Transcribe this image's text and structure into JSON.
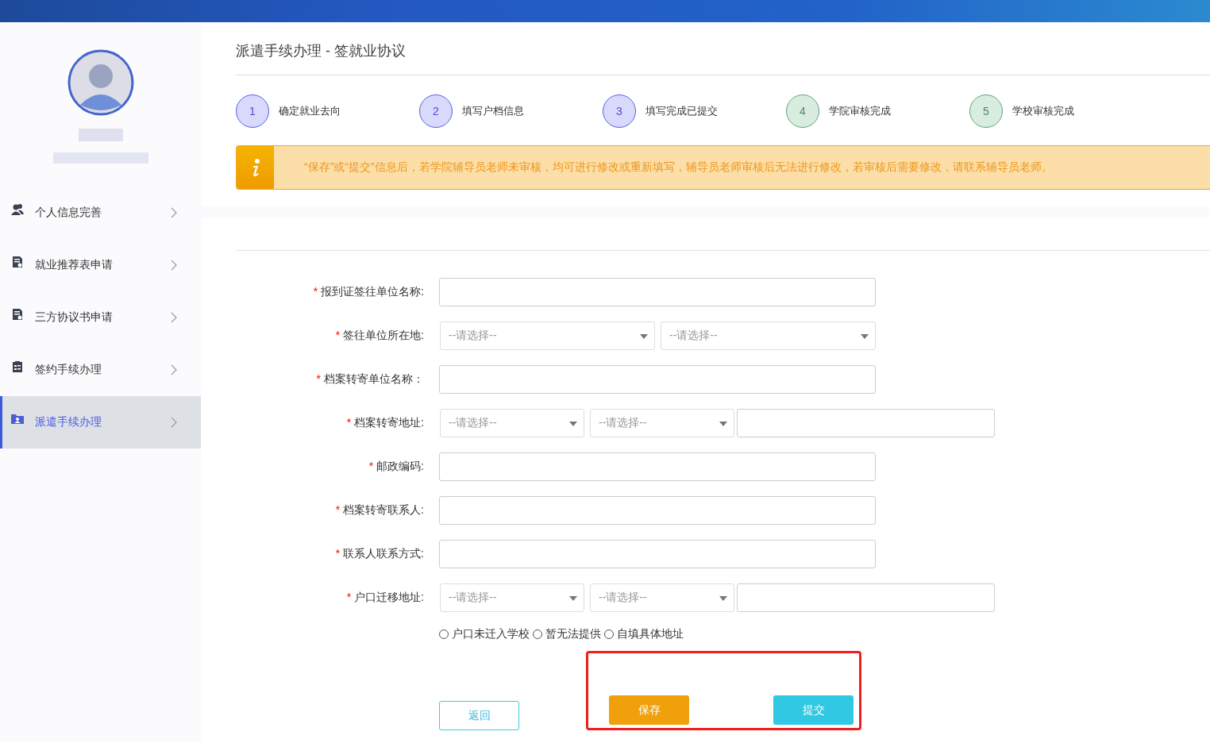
{
  "sidebar": {
    "items": [
      {
        "label": "个人信息完善",
        "kind": "user",
        "selected": false
      },
      {
        "label": "就业推荐表申请",
        "kind": "doc",
        "selected": false
      },
      {
        "label": "三方协议书申请",
        "kind": "doc",
        "selected": false
      },
      {
        "label": "签约手续办理",
        "kind": "clipboard",
        "selected": false
      },
      {
        "label": "派遣手续办理",
        "kind": "folder",
        "selected": true
      }
    ]
  },
  "page_title": "派遣手续办理 - 签就业协议",
  "steps": [
    {
      "number": "1",
      "label": "确定就业去向",
      "kind": "current"
    },
    {
      "number": "2",
      "label": "填写户档信息",
      "kind": "current"
    },
    {
      "number": "3",
      "label": "填写完成已提交",
      "kind": "current"
    },
    {
      "number": "4",
      "label": "学院审核完成",
      "kind": "upcoming"
    },
    {
      "number": "5",
      "label": "学校审核完成",
      "kind": "upcoming"
    }
  ],
  "notice": "“保存”或“提交”信息后，若学院辅导员老师未审核，均可进行修改或重新填写，辅导员老师审核后无法进行修改，若审核后需要修改，请联系辅导员老师。",
  "form": {
    "fields": [
      {
        "required_mark": "*",
        "label": "报到证签往单位名称:",
        "kind": "text"
      },
      {
        "required_mark": "*",
        "label": "签往单位所在地:",
        "kind": "select2",
        "placeholders": [
          "--请选择--",
          "--请选择--"
        ]
      },
      {
        "required_mark": "*",
        "label": "档案转寄单位名称：",
        "kind": "text"
      },
      {
        "required_mark": "*",
        "label": "档案转寄地址:",
        "kind": "select2text",
        "placeholders": [
          "--请选择--",
          "--请选择--"
        ]
      },
      {
        "required_mark": "*",
        "label": "邮政编码:",
        "kind": "text"
      },
      {
        "required_mark": "*",
        "label": "档案转寄联系人:",
        "kind": "text"
      },
      {
        "required_mark": "*",
        "label": "联系人联系方式:",
        "kind": "text"
      },
      {
        "required_mark": "*",
        "label": "户口迁移地址:",
        "kind": "select2text",
        "placeholders": [
          "--请选择--",
          "--请选择--"
        ]
      }
    ],
    "radios": [
      {
        "label": "户口未迁入学校",
        "selected": false
      },
      {
        "label": "暂无法提供",
        "selected": false
      },
      {
        "label": "自填具体地址",
        "selected": false
      }
    ]
  },
  "actions": {
    "back": "返回",
    "save": "保存",
    "submit": "提交",
    "highlighted": true
  }
}
